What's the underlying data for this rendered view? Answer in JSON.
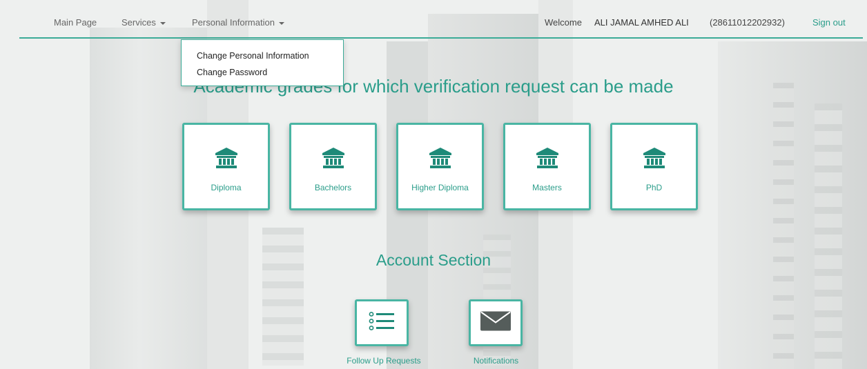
{
  "nav": {
    "main_page": "Main Page",
    "services": "Services",
    "personal_information": "Personal Information",
    "welcome": "Welcome",
    "username": "ALI JAMAL AMHED ALI",
    "user_id": "(28611012202932)",
    "sign_out": "Sign out"
  },
  "dropdown": {
    "items": [
      "Change Personal Information",
      "Change Password"
    ]
  },
  "grades": {
    "title": "Academic grades for which verification request can be made",
    "items": [
      {
        "label": "Diploma",
        "icon": "bank-icon"
      },
      {
        "label": "Bachelors",
        "icon": "bank-icon"
      },
      {
        "label": "Higher Diploma",
        "icon": "bank-icon"
      },
      {
        "label": "Masters",
        "icon": "bank-icon"
      },
      {
        "label": "PhD",
        "icon": "bank-icon"
      }
    ]
  },
  "account": {
    "title": "Account Section",
    "items": [
      {
        "label": "Follow Up Requests",
        "icon": "list-icon"
      },
      {
        "label": "Notifications",
        "icon": "envelope-icon"
      }
    ]
  },
  "colors": {
    "accent": "#2a9d8a",
    "border": "#49b5a3",
    "icon": "#1e8a78"
  }
}
